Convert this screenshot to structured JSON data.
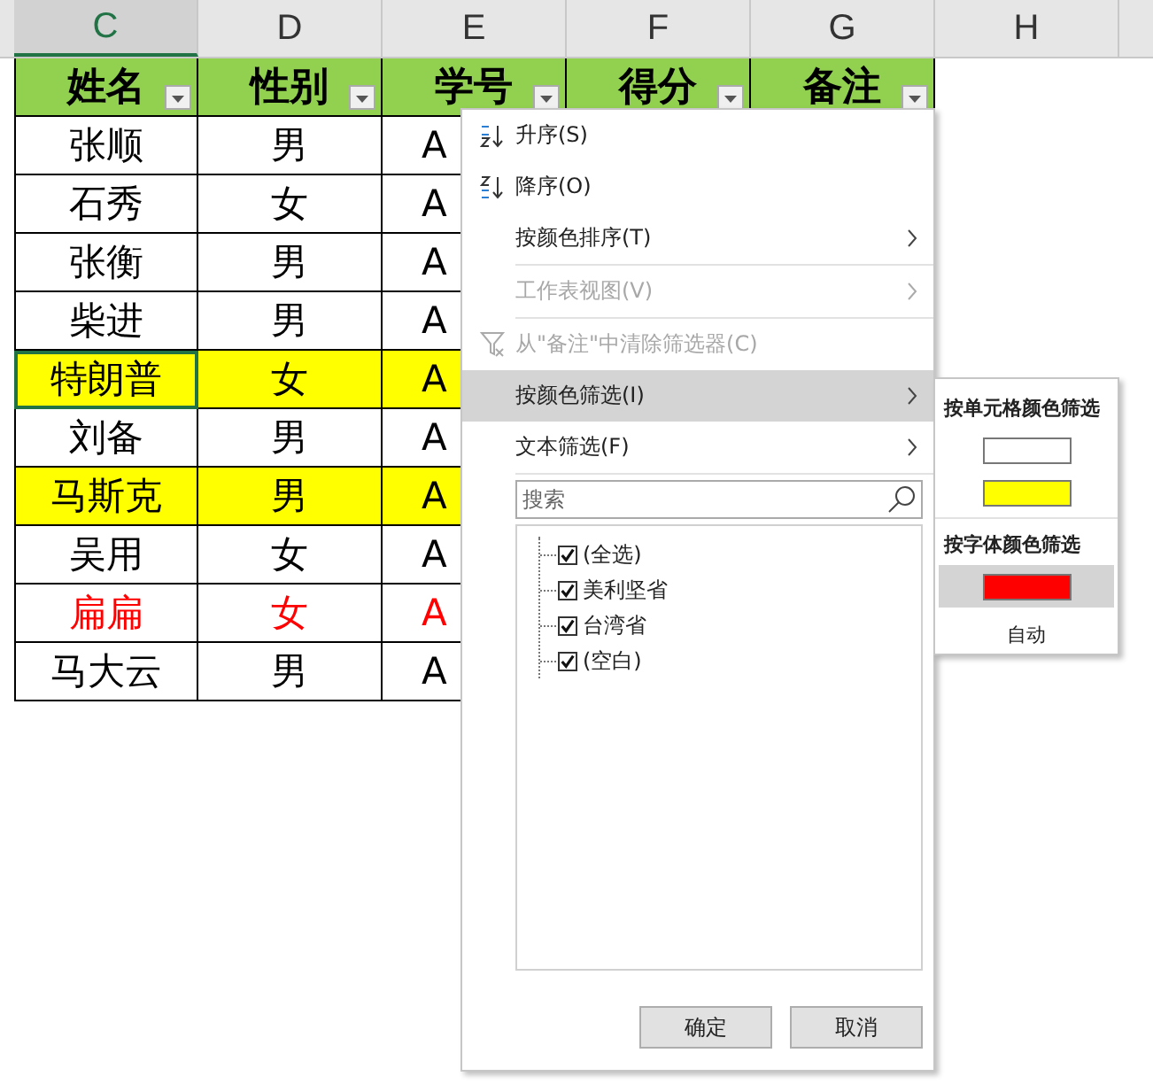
{
  "columns": [
    {
      "letter": "C",
      "selected": true
    },
    {
      "letter": "D",
      "selected": false
    },
    {
      "letter": "E",
      "selected": false
    },
    {
      "letter": "F",
      "selected": false
    },
    {
      "letter": "G",
      "selected": false
    },
    {
      "letter": "H",
      "selected": false
    }
  ],
  "headers": [
    {
      "label": "姓名"
    },
    {
      "label": "性别"
    },
    {
      "label": "学号"
    },
    {
      "label": "得分"
    },
    {
      "label": "备注"
    }
  ],
  "rows": [
    {
      "cells": [
        "张顺",
        "男",
        "A"
      ],
      "kind": "plain",
      "active": false
    },
    {
      "cells": [
        "石秀",
        "女",
        "A"
      ],
      "kind": "plain",
      "active": false
    },
    {
      "cells": [
        "张衡",
        "男",
        "A"
      ],
      "kind": "plain",
      "active": false
    },
    {
      "cells": [
        "柴进",
        "男",
        "A"
      ],
      "kind": "plain",
      "active": false
    },
    {
      "cells": [
        "特朗普",
        "女",
        "A"
      ],
      "kind": "yellow",
      "active": true
    },
    {
      "cells": [
        "刘备",
        "男",
        "A"
      ],
      "kind": "plain",
      "active": false
    },
    {
      "cells": [
        "马斯克",
        "男",
        "A"
      ],
      "kind": "yellow",
      "active": false
    },
    {
      "cells": [
        "吴用",
        "女",
        "A"
      ],
      "kind": "plain",
      "active": false
    },
    {
      "cells": [
        "扁扁",
        "女",
        "A"
      ],
      "kind": "red",
      "active": false
    },
    {
      "cells": [
        "马大云",
        "男",
        "A"
      ],
      "kind": "plain",
      "active": false
    }
  ],
  "menu": {
    "items": [
      {
        "kind": "sort_asc",
        "label": "升序(S)",
        "disabled": false,
        "highlighted": false,
        "submenu": false
      },
      {
        "kind": "sort_desc",
        "label": "降序(O)",
        "disabled": false,
        "highlighted": false,
        "submenu": false
      },
      {
        "kind": "plain",
        "label": "按颜色排序(T)",
        "disabled": false,
        "highlighted": false,
        "submenu": true
      },
      {
        "kind": "plain",
        "label": "工作表视图(V)",
        "disabled": true,
        "highlighted": false,
        "submenu": true
      },
      {
        "kind": "clear",
        "label": "从\"备注\"中清除筛选器(C)",
        "disabled": true,
        "highlighted": false,
        "submenu": false
      },
      {
        "kind": "plain",
        "label": "按颜色筛选(I)",
        "disabled": false,
        "highlighted": true,
        "submenu": true
      },
      {
        "kind": "plain",
        "label": "文本筛选(F)",
        "disabled": false,
        "highlighted": false,
        "submenu": true
      }
    ],
    "search": {
      "placeholder": "搜索"
    },
    "tree": {
      "label": "(全选)",
      "checked": true,
      "children": [
        {
          "label": "美利坚省",
          "checked": true
        },
        {
          "label": "台湾省",
          "checked": true
        },
        {
          "label": "(空白)",
          "checked": true
        }
      ]
    },
    "buttons": [
      "确定",
      "取消"
    ]
  },
  "color_submenu": {
    "sections": [
      {
        "title": "按单元格颜色筛选",
        "swatches": [
          {
            "color": "#ffffff",
            "selected": false
          },
          {
            "color": "#ffff00",
            "selected": false
          }
        ]
      },
      {
        "title": "按字体颜色筛选",
        "swatches": [
          {
            "color": "#ff0000",
            "selected": true
          }
        ]
      }
    ],
    "auto_label": "自动"
  }
}
